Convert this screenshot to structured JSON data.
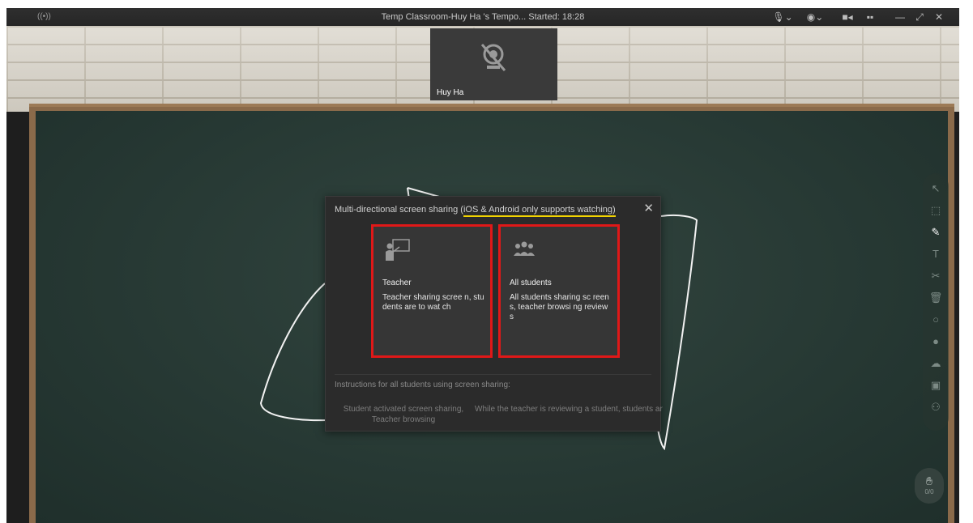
{
  "titlebar": {
    "live_icon": "((•))",
    "title": "Temp Classroom-Huy Ha 's Tempo...   Started: 18:28",
    "controls": [
      "mic-icon",
      "camera-icon",
      "video-icon",
      "grid-icon",
      "minimize-icon",
      "restore-icon",
      "close-icon"
    ],
    "mic_glyph": "🎙︎⌄",
    "cam_glyph": "◉⌄",
    "video_glyph": "■◂",
    "grid_glyph": "▪▪",
    "minimize_glyph": "—",
    "restore_glyph": "⤢",
    "close_glyph": "✕"
  },
  "video_tile": {
    "name": "Huy Ha",
    "icon": "camera-off-icon"
  },
  "dialog": {
    "header_prefix": "Multi-directional screen sharing (",
    "header_note": "iOS & Android only supports watching)",
    "close_glyph": "✕",
    "options": [
      {
        "title": "Teacher",
        "description": "Teacher sharing scree n, students are to wat ch",
        "icon": "teacher-board-icon"
      },
      {
        "title": "All students",
        "description": "All students sharing sc reens, teacher browsi ng reviews",
        "icon": "students-group-icon"
      }
    ],
    "instructions_title": "Instructions for all students using screen sharing:",
    "instruction_1": "Student activated screen sharing, Teacher browsing",
    "instruction_2": "While the teacher is reviewing a student, students are to take on the teacher's persp"
  },
  "toolbar": {
    "tools": [
      {
        "name": "cursor-icon",
        "glyph": "↖"
      },
      {
        "name": "marquee-select-icon",
        "glyph": "⬚"
      },
      {
        "name": "pen-icon",
        "glyph": "✎"
      },
      {
        "name": "text-icon",
        "glyph": "T"
      },
      {
        "name": "scissors-icon",
        "glyph": "✂"
      },
      {
        "name": "trash-icon",
        "glyph": "🗑︎"
      },
      {
        "name": "shape-icon",
        "glyph": "○"
      },
      {
        "name": "chat-icon",
        "glyph": "●"
      },
      {
        "name": "cloud-icon",
        "glyph": "☁"
      },
      {
        "name": "toolbox-icon",
        "glyph": "▣"
      },
      {
        "name": "users-icon",
        "glyph": "⚇"
      }
    ],
    "active_tool": "pen-icon"
  },
  "hand_raise": {
    "glyph": "✋︎",
    "count": "0/0"
  },
  "colors": {
    "highlight_outline": "#e01818",
    "underline": "#f2d400",
    "board": "#263833"
  }
}
